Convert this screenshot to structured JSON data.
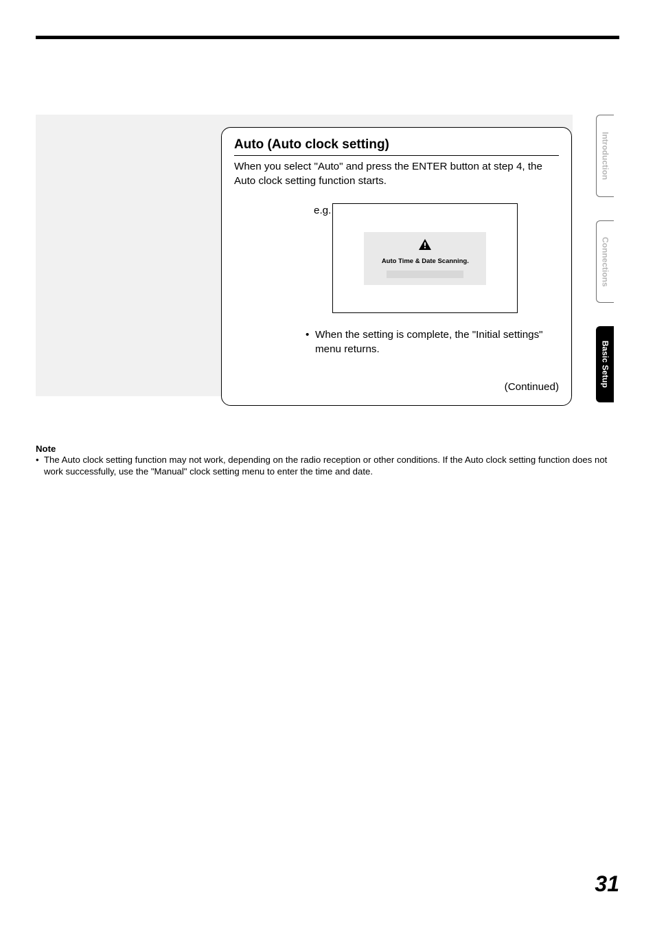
{
  "box": {
    "title": "Auto (Auto clock setting)",
    "intro": "When you select \"Auto\" and press the ENTER button at step 4, the Auto clock setting function starts.",
    "eg_label": "e.g.",
    "osd_text": "Auto Time & Date Scanning.",
    "bullet": "When the setting is complete, the \"Initial settings\" menu returns.",
    "continued": "(Continued)"
  },
  "note": {
    "title": "Note",
    "body": "The Auto clock setting function may not work, depending on the radio reception or other conditions. If the Auto clock setting function does not work successfully, use the \"Manual\" clock setting menu to enter the time and date."
  },
  "tabs": {
    "introduction": "Introduction",
    "connections": "Connections",
    "basic_setup": "Basic Setup"
  },
  "page_number": "31"
}
